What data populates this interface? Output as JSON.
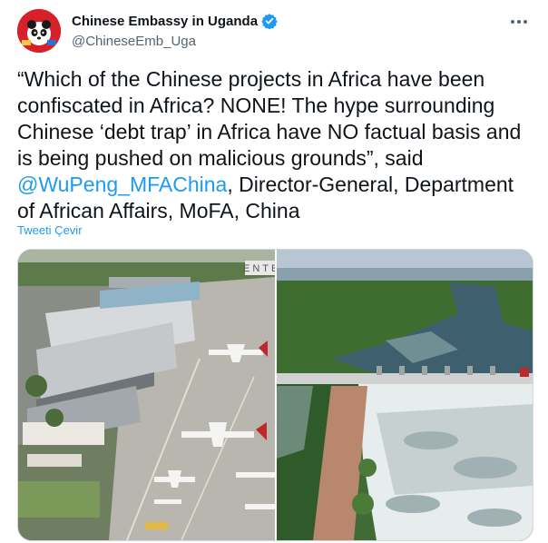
{
  "author": {
    "display_name": "Chinese Embassy in Uganda",
    "handle": "@ChineseEmb_Uga",
    "avatar_icon": "embassy-avatar-icon",
    "verified_icon": "verified-badge-icon",
    "more_icon": "more-options-icon"
  },
  "tweet": {
    "text_before": "“Which of the Chinese projects in Africa have been confiscated in Africa? NONE! The hype surrounding Chinese ‘debt trap’ in Africa have NO factual basis and is being pushed on malicious grounds”, said ",
    "mention": "@WuPeng_MFAChina",
    "text_after": ", Director-General, Department of African Affairs, MoFA, China",
    "translate_label": "Tweeti Çevir"
  },
  "media": {
    "photos": [
      {
        "subject": "airport-terminal-aerial-photo",
        "sign_text": "ENTE"
      },
      {
        "subject": "hydropower-dam-river-aerial-photo"
      }
    ]
  },
  "colors": {
    "link": "#1d9bf0",
    "text": "#0f1419",
    "secondary": "#536471",
    "avatar_bg": "#d6212a"
  }
}
